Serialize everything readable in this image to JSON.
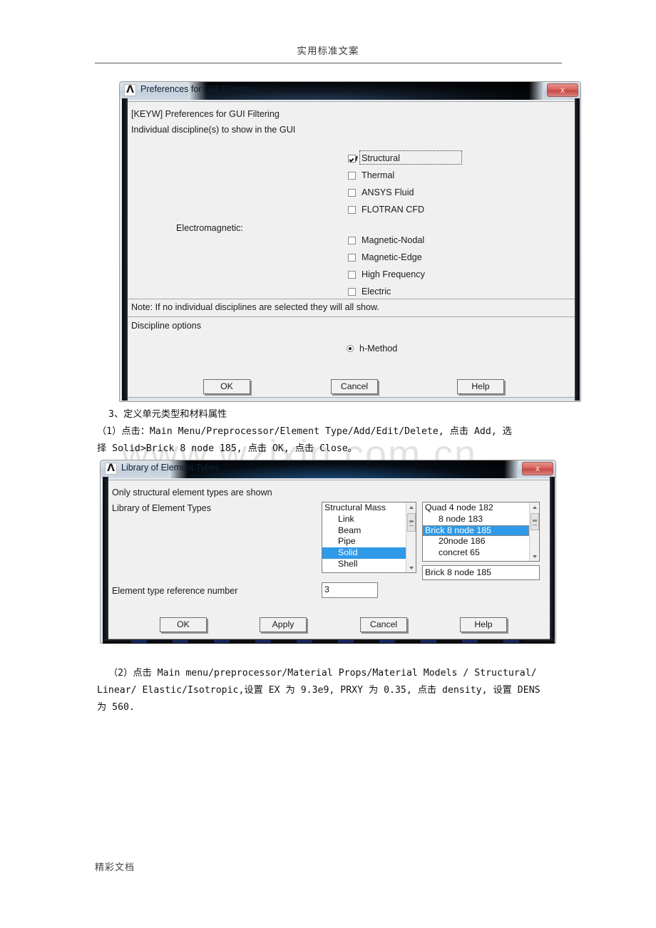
{
  "document": {
    "header": "实用标准文案",
    "footer": "精彩文档",
    "watermark": "www.wzixin.com.cn",
    "paragraphs": {
      "section3_title": "3、定义单元类型和材料属性",
      "step1": "（1）点击：Main Menu/Preprocessor/Element Type/Add/Edit/Delete, 点击 Add, 选\n择 Solid>Brick 8 node 185, 点击 OK, 点击 Close。",
      "step2_lead": "（2）点击 Main menu/preprocessor/Material Props/Material Models / Structural/",
      "step2_rest": "Linear/ Elastic/Isotropic,设置 EX 为 9.3e9, PRXY 为 0.35, 点击 density, 设置 DENS\n为 560."
    }
  },
  "prefs_dialog": {
    "icon": "ansys-lambda-icon",
    "title": "Preferences for GUI Filtering",
    "close_label": "x",
    "keyw_label": "[KEYW] Preferences for GUI Filtering",
    "individual_label": "Individual discipline(s) to show in the GUI",
    "electromagnetic_label": "Electromagnetic:",
    "note": "Note: If no individual disciplines are selected they will all show.",
    "discipline_options_label": "Discipline options",
    "checkboxes": [
      {
        "label": "Structural",
        "checked": true,
        "focused": true
      },
      {
        "label": "Thermal",
        "checked": false,
        "focused": false
      },
      {
        "label": "ANSYS Fluid",
        "checked": false,
        "focused": false
      },
      {
        "label": "FLOTRAN CFD",
        "checked": false,
        "focused": false
      }
    ],
    "em_checkboxes": [
      {
        "label": "Magnetic-Nodal",
        "checked": false
      },
      {
        "label": "Magnetic-Edge",
        "checked": false
      },
      {
        "label": "High Frequency",
        "checked": false
      },
      {
        "label": "Electric",
        "checked": false
      }
    ],
    "radios": [
      {
        "label": "h-Method",
        "selected": true
      }
    ],
    "buttons": [
      {
        "label": "OK"
      },
      {
        "label": "Cancel"
      },
      {
        "label": "Help"
      }
    ]
  },
  "library_dialog": {
    "icon": "ansys-lambda-icon",
    "title": "Library of Element Types",
    "close_label": "x",
    "note": "Only structural element types are shown",
    "list_label": "Library of Element Types",
    "ref_num_label": "Element type reference number",
    "ref_num_value": "3",
    "selected_readout": "Brick 8 node 185",
    "left_list": [
      {
        "label": "Structural Mass",
        "indent": false,
        "selected": false
      },
      {
        "label": "Link",
        "indent": true,
        "selected": false
      },
      {
        "label": "Beam",
        "indent": true,
        "selected": false
      },
      {
        "label": "Pipe",
        "indent": true,
        "selected": false
      },
      {
        "label": "Solid",
        "indent": true,
        "selected": true
      },
      {
        "label": "Shell",
        "indent": true,
        "selected": false
      }
    ],
    "right_list": [
      {
        "label": "Quad  4 node 182",
        "indent": false,
        "selected": false
      },
      {
        "label": "8 node 183",
        "indent": true,
        "selected": false
      },
      {
        "label": "Brick 8 node 185",
        "indent": false,
        "selected": true
      },
      {
        "label": "20node 186",
        "indent": true,
        "selected": false
      },
      {
        "label": "concret 65",
        "indent": true,
        "selected": false
      }
    ],
    "buttons": [
      {
        "label": "OK"
      },
      {
        "label": "Apply"
      },
      {
        "label": "Cancel"
      },
      {
        "label": "Help"
      }
    ]
  },
  "colors": {
    "selection_blue": "#2f9ae8",
    "dialog_face": "#f0f0f0",
    "close_red": "#c64a46",
    "watermark_gray": "#e2e2e2"
  }
}
